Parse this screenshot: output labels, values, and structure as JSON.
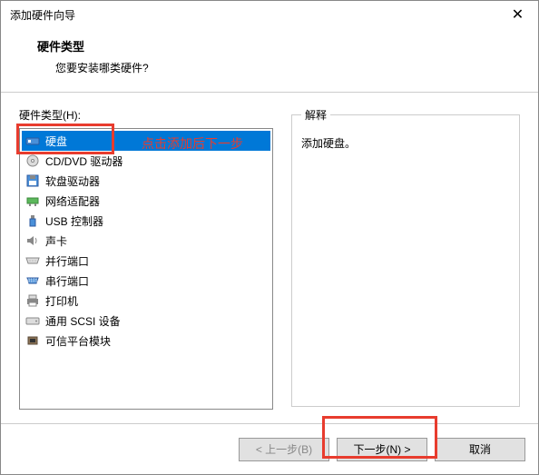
{
  "titlebar": {
    "title": "添加硬件向导"
  },
  "header": {
    "title": "硬件类型",
    "subtitle": "您要安装哪类硬件?"
  },
  "left": {
    "label": "硬件类型(H):",
    "items": [
      {
        "label": "硬盘",
        "icon": "disk"
      },
      {
        "label": "CD/DVD 驱动器",
        "icon": "cd"
      },
      {
        "label": "软盘驱动器",
        "icon": "floppy"
      },
      {
        "label": "网络适配器",
        "icon": "network"
      },
      {
        "label": "USB 控制器",
        "icon": "usb"
      },
      {
        "label": "声卡",
        "icon": "sound"
      },
      {
        "label": "并行端口",
        "icon": "parallel"
      },
      {
        "label": "串行端口",
        "icon": "serial"
      },
      {
        "label": "打印机",
        "icon": "printer"
      },
      {
        "label": "通用 SCSI 设备",
        "icon": "scsi"
      },
      {
        "label": "可信平台模块",
        "icon": "tpm"
      }
    ]
  },
  "right": {
    "legend": "解释",
    "description": "添加硬盘。"
  },
  "footer": {
    "back": "< 上一步(B)",
    "next": "下一步(N) >",
    "cancel": "取消"
  },
  "annotation": {
    "text": "点击添加后下一步"
  }
}
